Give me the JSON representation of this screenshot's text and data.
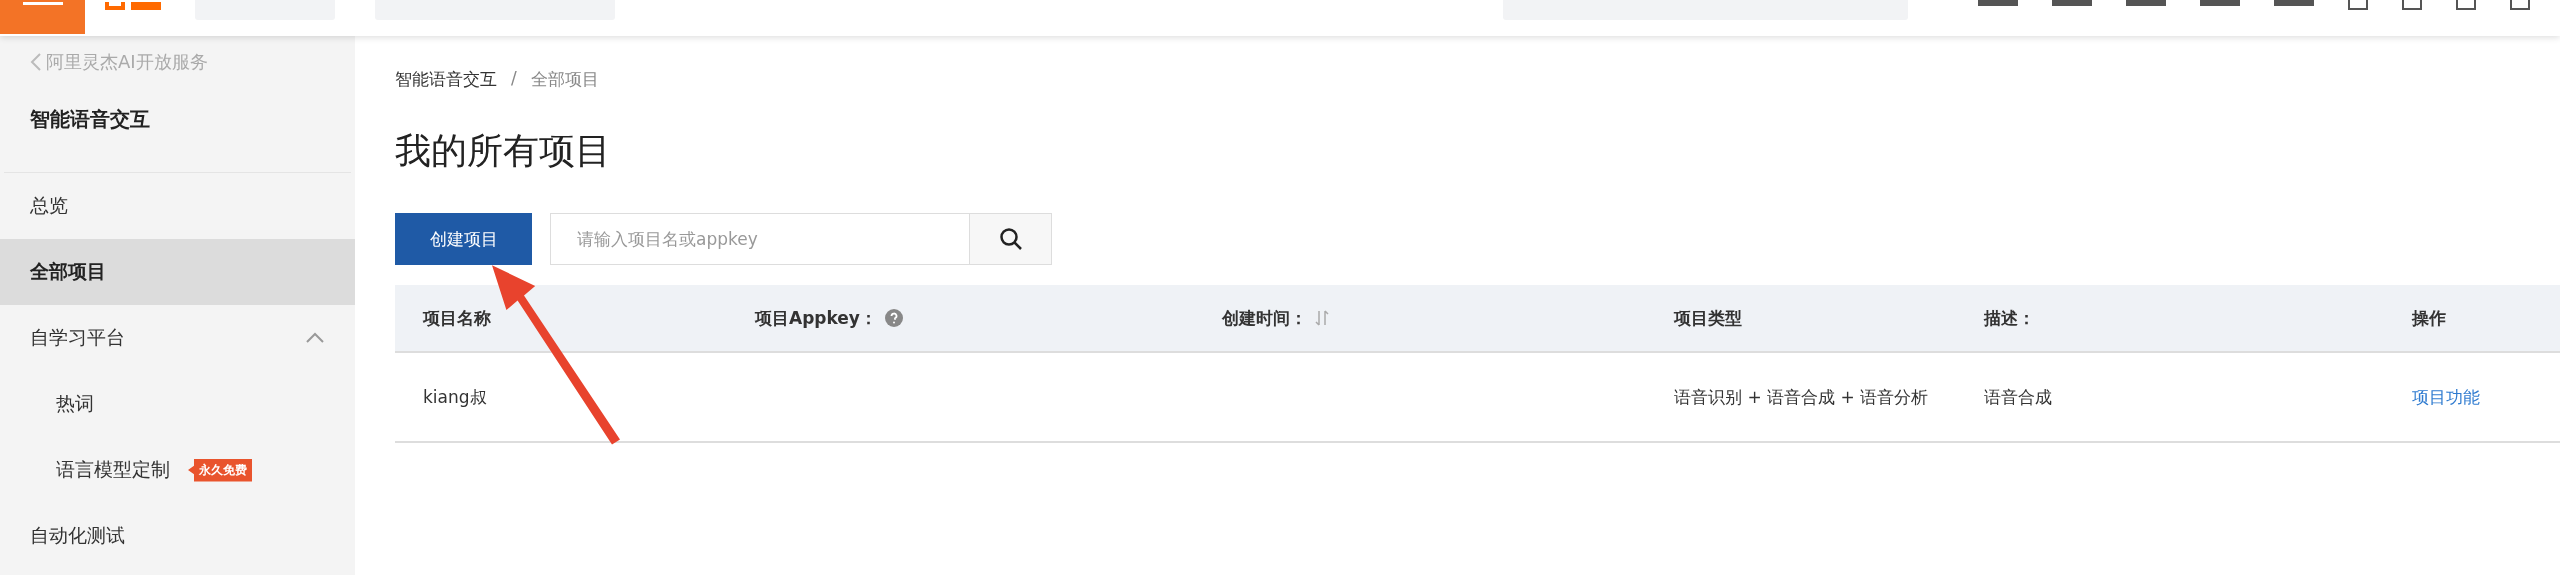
{
  "sidebar": {
    "back_link": "阿里灵杰AI开放服务",
    "title": "智能语音交互",
    "items": [
      {
        "label": "总览",
        "selected": false
      },
      {
        "label": "全部项目",
        "selected": true
      },
      {
        "label": "自学习平台",
        "selected": false,
        "expanded": true,
        "children": [
          {
            "label": "热词",
            "selected": false
          },
          {
            "label": "语言模型定制",
            "selected": false,
            "badge": "永久免费"
          }
        ]
      },
      {
        "label": "自动化测试",
        "selected": false
      }
    ]
  },
  "breadcrumb": {
    "separator": "/",
    "items": [
      "智能语音交互",
      "全部项目"
    ]
  },
  "page_title": "我的所有项目",
  "create_button": "创建项目",
  "search": {
    "placeholder": "请输入项目名或appkey"
  },
  "table": {
    "columns": [
      {
        "label": "项目名称",
        "kind": "plain"
      },
      {
        "label": "项目Appkey：",
        "kind": "help"
      },
      {
        "label": "创建时间：",
        "kind": "sortable"
      },
      {
        "label": "项目类型",
        "kind": "plain"
      },
      {
        "label": "描述：",
        "kind": "plain"
      },
      {
        "label": "操作",
        "kind": "plain"
      }
    ],
    "rows": [
      {
        "name": "kiang叔",
        "type": "语音识别 + 语音合成 + 语音分析",
        "description": "语音合成",
        "action": "项目功能"
      }
    ]
  }
}
